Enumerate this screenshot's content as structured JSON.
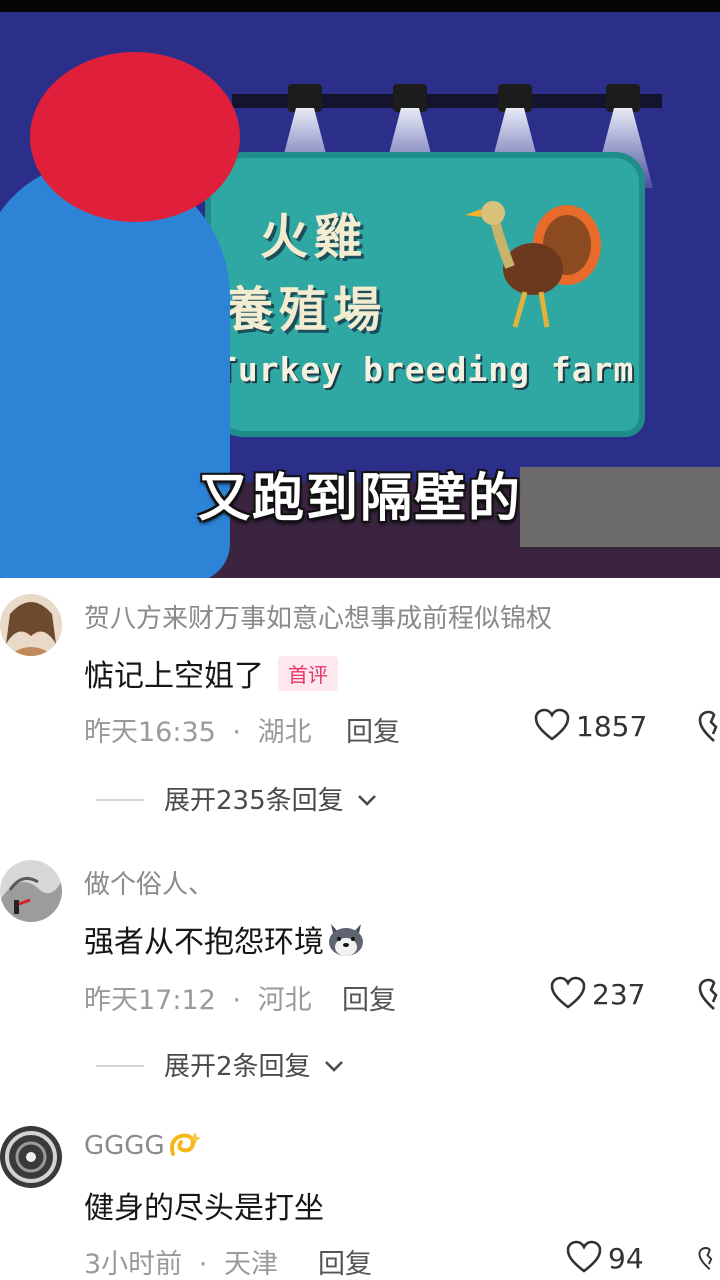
{
  "video": {
    "sign": {
      "cn_line1": "火雞",
      "cn_line2": "養殖場",
      "en_text": "Turkey breeding farm"
    },
    "subtitle": "又跑到隔壁的"
  },
  "comments": [
    {
      "username": "贺八方来财万事如意心想事成前程似锦权",
      "text": "惦记上空姐了",
      "badge": "首评",
      "time": "昨天16:35",
      "location": "湖北",
      "reply_label": "回复",
      "likes": "1857",
      "expand_label": "展开235条回复"
    },
    {
      "username": "做个俗人、",
      "text": "强者从不抱怨环境",
      "emoji": "husky-dog-emoji",
      "time": "昨天17:12",
      "location": "河北",
      "reply_label": "回复",
      "likes": "237",
      "expand_label": "展开2条回复"
    },
    {
      "username": "GGGG",
      "username_emoji": "dizzy-emoji",
      "text": "健身的尽头是打坐",
      "time": "3小时前",
      "location": "天津",
      "reply_label": "回复",
      "likes": "94"
    }
  ],
  "meta_separator": "·",
  "colors": {
    "badge_text": "#e8336b",
    "badge_bg": "#fde8ee",
    "meta_gray": "#9a9a9a"
  }
}
